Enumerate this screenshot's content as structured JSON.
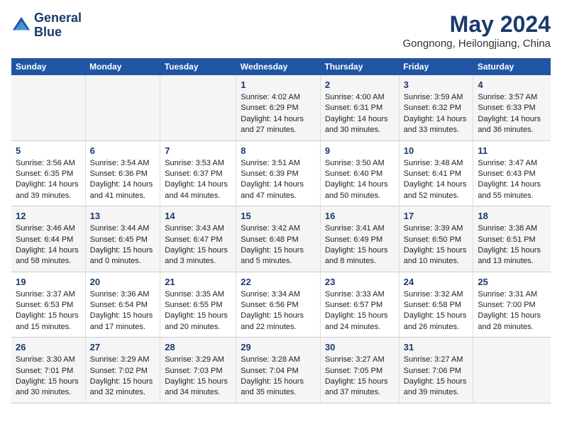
{
  "logo": {
    "line1": "General",
    "line2": "Blue"
  },
  "title": "May 2024",
  "subtitle": "Gongnong, Heilongjiang, China",
  "days_of_week": [
    "Sunday",
    "Monday",
    "Tuesday",
    "Wednesday",
    "Thursday",
    "Friday",
    "Saturday"
  ],
  "weeks": [
    [
      {
        "day": "",
        "info": ""
      },
      {
        "day": "",
        "info": ""
      },
      {
        "day": "",
        "info": ""
      },
      {
        "day": "1",
        "info": "Sunrise: 4:02 AM\nSunset: 6:29 PM\nDaylight: 14 hours and 27 minutes."
      },
      {
        "day": "2",
        "info": "Sunrise: 4:00 AM\nSunset: 6:31 PM\nDaylight: 14 hours and 30 minutes."
      },
      {
        "day": "3",
        "info": "Sunrise: 3:59 AM\nSunset: 6:32 PM\nDaylight: 14 hours and 33 minutes."
      },
      {
        "day": "4",
        "info": "Sunrise: 3:57 AM\nSunset: 6:33 PM\nDaylight: 14 hours and 36 minutes."
      }
    ],
    [
      {
        "day": "5",
        "info": "Sunrise: 3:56 AM\nSunset: 6:35 PM\nDaylight: 14 hours and 39 minutes."
      },
      {
        "day": "6",
        "info": "Sunrise: 3:54 AM\nSunset: 6:36 PM\nDaylight: 14 hours and 41 minutes."
      },
      {
        "day": "7",
        "info": "Sunrise: 3:53 AM\nSunset: 6:37 PM\nDaylight: 14 hours and 44 minutes."
      },
      {
        "day": "8",
        "info": "Sunrise: 3:51 AM\nSunset: 6:39 PM\nDaylight: 14 hours and 47 minutes."
      },
      {
        "day": "9",
        "info": "Sunrise: 3:50 AM\nSunset: 6:40 PM\nDaylight: 14 hours and 50 minutes."
      },
      {
        "day": "10",
        "info": "Sunrise: 3:48 AM\nSunset: 6:41 PM\nDaylight: 14 hours and 52 minutes."
      },
      {
        "day": "11",
        "info": "Sunrise: 3:47 AM\nSunset: 6:43 PM\nDaylight: 14 hours and 55 minutes."
      }
    ],
    [
      {
        "day": "12",
        "info": "Sunrise: 3:46 AM\nSunset: 6:44 PM\nDaylight: 14 hours and 58 minutes."
      },
      {
        "day": "13",
        "info": "Sunrise: 3:44 AM\nSunset: 6:45 PM\nDaylight: 15 hours and 0 minutes."
      },
      {
        "day": "14",
        "info": "Sunrise: 3:43 AM\nSunset: 6:47 PM\nDaylight: 15 hours and 3 minutes."
      },
      {
        "day": "15",
        "info": "Sunrise: 3:42 AM\nSunset: 6:48 PM\nDaylight: 15 hours and 5 minutes."
      },
      {
        "day": "16",
        "info": "Sunrise: 3:41 AM\nSunset: 6:49 PM\nDaylight: 15 hours and 8 minutes."
      },
      {
        "day": "17",
        "info": "Sunrise: 3:39 AM\nSunset: 6:50 PM\nDaylight: 15 hours and 10 minutes."
      },
      {
        "day": "18",
        "info": "Sunrise: 3:38 AM\nSunset: 6:51 PM\nDaylight: 15 hours and 13 minutes."
      }
    ],
    [
      {
        "day": "19",
        "info": "Sunrise: 3:37 AM\nSunset: 6:53 PM\nDaylight: 15 hours and 15 minutes."
      },
      {
        "day": "20",
        "info": "Sunrise: 3:36 AM\nSunset: 6:54 PM\nDaylight: 15 hours and 17 minutes."
      },
      {
        "day": "21",
        "info": "Sunrise: 3:35 AM\nSunset: 6:55 PM\nDaylight: 15 hours and 20 minutes."
      },
      {
        "day": "22",
        "info": "Sunrise: 3:34 AM\nSunset: 6:56 PM\nDaylight: 15 hours and 22 minutes."
      },
      {
        "day": "23",
        "info": "Sunrise: 3:33 AM\nSunset: 6:57 PM\nDaylight: 15 hours and 24 minutes."
      },
      {
        "day": "24",
        "info": "Sunrise: 3:32 AM\nSunset: 6:58 PM\nDaylight: 15 hours and 26 minutes."
      },
      {
        "day": "25",
        "info": "Sunrise: 3:31 AM\nSunset: 7:00 PM\nDaylight: 15 hours and 28 minutes."
      }
    ],
    [
      {
        "day": "26",
        "info": "Sunrise: 3:30 AM\nSunset: 7:01 PM\nDaylight: 15 hours and 30 minutes."
      },
      {
        "day": "27",
        "info": "Sunrise: 3:29 AM\nSunset: 7:02 PM\nDaylight: 15 hours and 32 minutes."
      },
      {
        "day": "28",
        "info": "Sunrise: 3:29 AM\nSunset: 7:03 PM\nDaylight: 15 hours and 34 minutes."
      },
      {
        "day": "29",
        "info": "Sunrise: 3:28 AM\nSunset: 7:04 PM\nDaylight: 15 hours and 35 minutes."
      },
      {
        "day": "30",
        "info": "Sunrise: 3:27 AM\nSunset: 7:05 PM\nDaylight: 15 hours and 37 minutes."
      },
      {
        "day": "31",
        "info": "Sunrise: 3:27 AM\nSunset: 7:06 PM\nDaylight: 15 hours and 39 minutes."
      },
      {
        "day": "",
        "info": ""
      }
    ]
  ]
}
